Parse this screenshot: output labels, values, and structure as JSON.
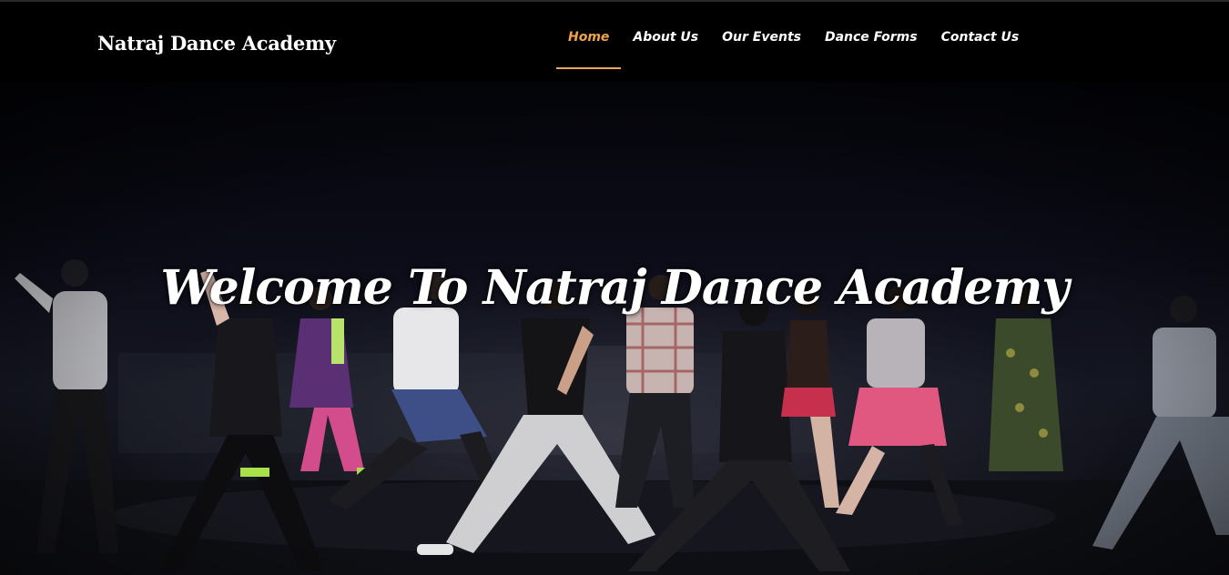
{
  "navbar": {
    "brand": "Natraj Dance Academy",
    "items": [
      {
        "label": "Home",
        "active": true
      },
      {
        "label": "About Us",
        "active": false
      },
      {
        "label": "Our Events",
        "active": false
      },
      {
        "label": "Dance Forms",
        "active": false
      },
      {
        "label": "Contact Us",
        "active": false
      }
    ],
    "accent_color": "#f0a44a"
  },
  "hero": {
    "title": "Welcome To Natraj Dance Academy",
    "background_image": "dance-troupe-photo"
  }
}
